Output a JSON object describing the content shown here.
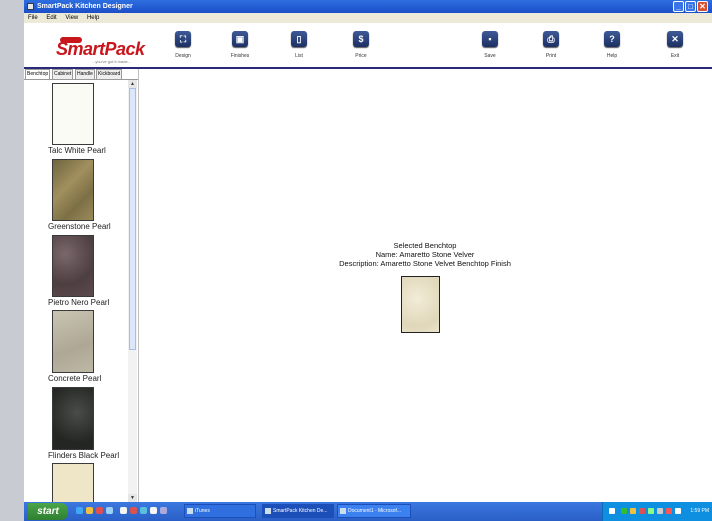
{
  "window": {
    "title": "SmartPack Kitchen Designer",
    "min_icon": "_",
    "max_icon": "□",
    "close_icon": "✕"
  },
  "menu": [
    "File",
    "Edit",
    "View",
    "Help"
  ],
  "logo": {
    "brand": "SmartPack",
    "tagline": "...you've got it made..."
  },
  "toolbar": [
    {
      "label": "Design",
      "icon": "design-icon",
      "glyph": "⛶"
    },
    {
      "label": "Finishes",
      "icon": "finishes-icon",
      "glyph": "▣"
    },
    {
      "label": "List",
      "icon": "list-icon",
      "glyph": "▯"
    },
    {
      "label": "Price",
      "icon": "price-icon",
      "glyph": "$"
    },
    {
      "label": "Save",
      "icon": "save-icon",
      "glyph": "▪"
    },
    {
      "label": "Print",
      "icon": "print-icon",
      "glyph": "⎙"
    },
    {
      "label": "Help",
      "icon": "help-icon",
      "glyph": "?"
    },
    {
      "label": "Exit",
      "icon": "exit-icon",
      "glyph": "✕"
    }
  ],
  "tabs": [
    "Benchtop",
    "Cabinet",
    "Handle",
    "Kickboard"
  ],
  "finishes": [
    {
      "name": "Talc White Pearl",
      "color": "#fbfbf5"
    },
    {
      "name": "Greenstone Pearl",
      "color": "#8b7a4b"
    },
    {
      "name": "Pietro Nero Pearl",
      "color": "#5c4b4e"
    },
    {
      "name": "Concrete Pearl",
      "color": "#bdb7a5"
    },
    {
      "name": "Flinders Black Pearl",
      "color": "#2d2f2c"
    },
    {
      "name": "",
      "color": "#eee6c7"
    }
  ],
  "scroll": {
    "up": "▲",
    "down": "▼"
  },
  "selected": {
    "heading": "Selected Benchtop",
    "name_line": "Name: Amaretto Stone Velver",
    "description_line": "Description: Amaretto Stone Velvet Benchtop Finish",
    "color": "#ece4cc"
  },
  "taskbar": {
    "start": "start",
    "items": [
      "iTunes",
      "SmartPack Kitchen De...",
      "Document1 - Microsof..."
    ],
    "clock": "1:59 PM"
  }
}
